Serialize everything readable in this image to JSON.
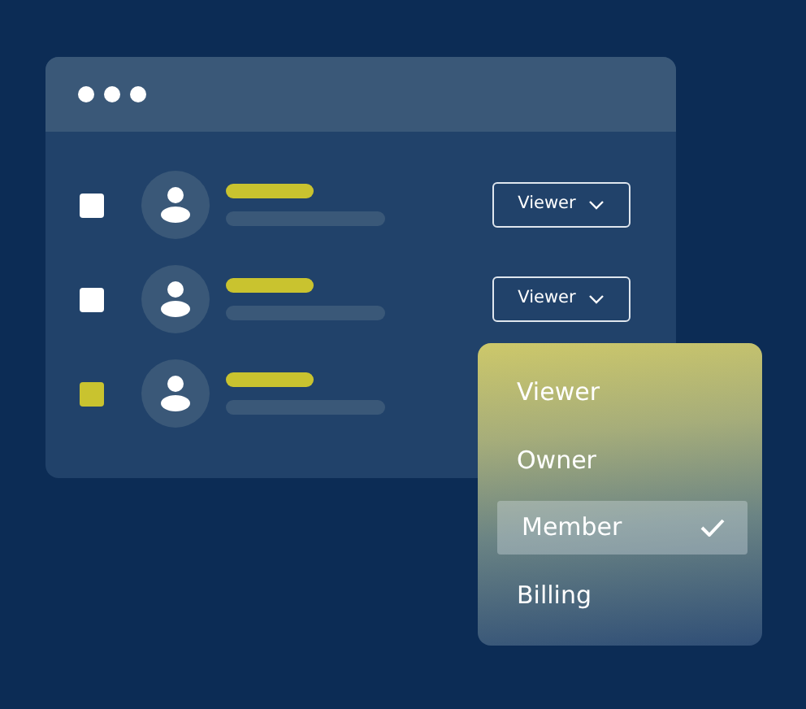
{
  "window": {
    "rows": [
      {
        "checked": false,
        "role": "Viewer"
      },
      {
        "checked": false,
        "role": "Viewer"
      },
      {
        "checked": true
      }
    ]
  },
  "role_menu": {
    "items": [
      {
        "label": "Viewer",
        "selected": false
      },
      {
        "label": "Owner",
        "selected": false
      },
      {
        "label": "Member",
        "selected": true
      },
      {
        "label": "Billing",
        "selected": false
      }
    ]
  }
}
